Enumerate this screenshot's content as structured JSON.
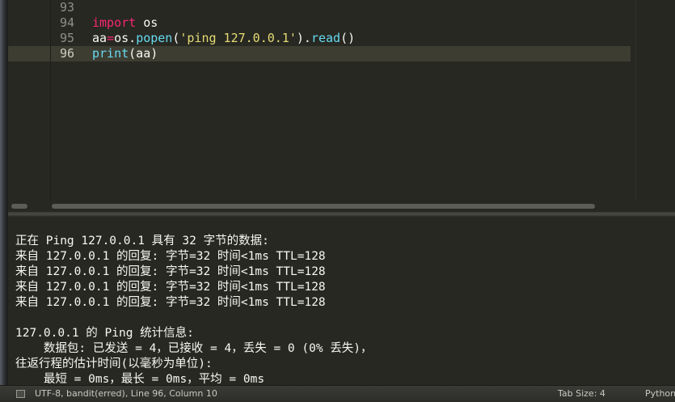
{
  "editor": {
    "lines": [
      {
        "number": "93",
        "text": ""
      },
      {
        "number": "94",
        "kw": "import",
        "rest": " os"
      },
      {
        "number": "95",
        "p1": "aa",
        "op": "=",
        "p2": "os.",
        "fn": "popen",
        "p3": "(",
        "str": "'ping 127.0.0.1'",
        "p4": ").",
        "fn2": "read",
        "p5": "()"
      },
      {
        "number": "96",
        "fn": "print",
        "rest": "(aa)"
      }
    ]
  },
  "output": {
    "lines": [
      "正在 Ping 127.0.0.1 具有 32 字节的数据:",
      "来自 127.0.0.1 的回复: 字节=32 时间<1ms TTL=128",
      "来自 127.0.0.1 的回复: 字节=32 时间<1ms TTL=128",
      "来自 127.0.0.1 的回复: 字节=32 时间<1ms TTL=128",
      "来自 127.0.0.1 的回复: 字节=32 时间<1ms TTL=128",
      "",
      "127.0.0.1 的 Ping 统计信息:",
      "    数据包: 已发送 = 4，已接收 = 4，丢失 = 0 (0% 丢失)，",
      "往返行程的估计时间(以毫秒为单位):",
      "    最短 = 0ms，最长 = 0ms，平均 = 0ms"
    ]
  },
  "status": {
    "info": "UTF-8, bandit(erred), Line 96, Column 10",
    "tab_size": "Tab Size: 4",
    "syntax": "Python"
  },
  "colors": {
    "background": "#272822",
    "keyword": "#f92672",
    "function": "#66d9ef",
    "string": "#e6db74",
    "text": "#f8f8f2"
  }
}
